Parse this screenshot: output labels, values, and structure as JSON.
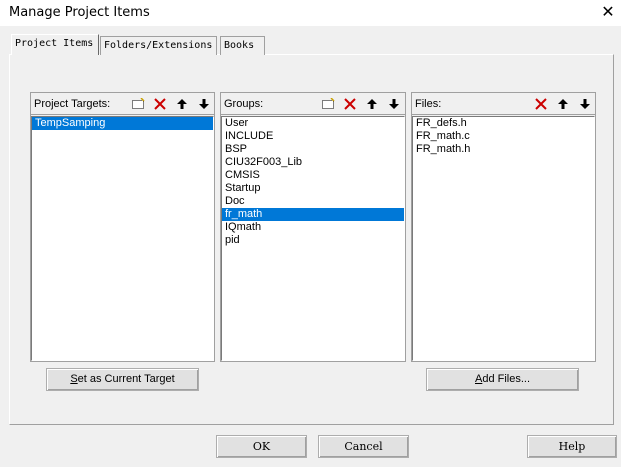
{
  "window": {
    "title": "Manage Project Items",
    "close_symbol": "✕"
  },
  "tabs": [
    {
      "label": "Project Items",
      "active": true
    },
    {
      "label": "Folders/Extensions",
      "active": false
    },
    {
      "label": "Books",
      "active": false
    }
  ],
  "targets": {
    "label": "Project Targets:",
    "items": [
      "TempSamping"
    ],
    "selected_index": 0
  },
  "groups": {
    "label": "Groups:",
    "items": [
      "User",
      "INCLUDE",
      "BSP",
      "CIU32F003_Lib",
      "CMSIS",
      "Startup",
      "Doc",
      "fr_math",
      "IQmath",
      "pid"
    ],
    "selected_index": 7
  },
  "files": {
    "label": "Files:",
    "items": [
      "FR_defs.h",
      "FR_math.c",
      "FR_math.h"
    ]
  },
  "buttons": {
    "set_current_target": {
      "prefix": "",
      "accel": "S",
      "rest": "et as Current Target"
    },
    "add_files": {
      "prefix": "",
      "accel": "A",
      "rest": "dd Files..."
    },
    "ok": "OK",
    "cancel": "Cancel",
    "help": "Help"
  },
  "colors": {
    "selection": "#0078d7",
    "delete_red": "#cc0000"
  },
  "icons": [
    "new-item-icon",
    "delete-icon",
    "move-up-icon",
    "move-down-icon"
  ]
}
